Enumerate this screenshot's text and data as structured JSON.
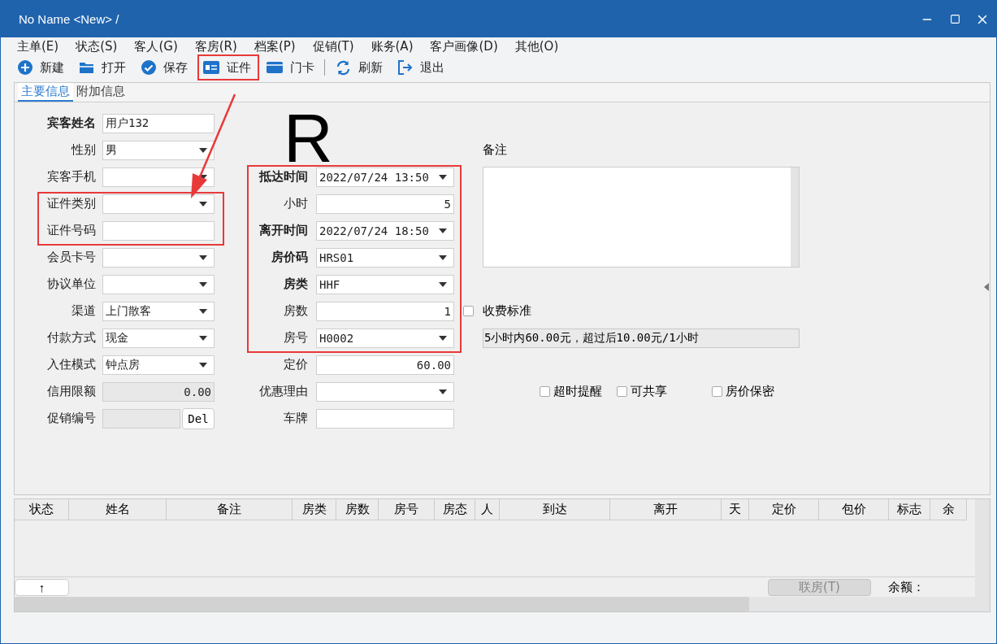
{
  "window": {
    "title": "No Name <New> /"
  },
  "menu": [
    "主单(E)",
    "状态(S)",
    "客人(G)",
    "客房(R)",
    "档案(P)",
    "促销(T)",
    "账务(A)",
    "客户画像(D)",
    "其他(O)"
  ],
  "toolbar": [
    {
      "kind": "new",
      "label": "新建",
      "highlighted": false
    },
    {
      "kind": "open",
      "label": "打开",
      "highlighted": false
    },
    {
      "kind": "save",
      "label": "保存",
      "highlighted": false
    },
    {
      "kind": "id",
      "label": "证件",
      "highlighted": true
    },
    {
      "kind": "card",
      "label": "门卡",
      "highlighted": false
    },
    {
      "kind": "separator"
    },
    {
      "kind": "refresh",
      "label": "刷新",
      "highlighted": false
    },
    {
      "kind": "exit",
      "label": "退出",
      "highlighted": false
    }
  ],
  "tabs": [
    {
      "label": "主要信息",
      "selected": true
    },
    {
      "label": "附加信息",
      "selected": false
    }
  ],
  "marker": "R",
  "left_fields": [
    {
      "label": "宾客姓名",
      "bold": true,
      "kind": "text",
      "value": "用户132",
      "highlighted": false
    },
    {
      "label": "性别",
      "bold": false,
      "kind": "dropdown",
      "value": "男",
      "highlighted": false
    },
    {
      "label": "宾客手机",
      "bold": false,
      "kind": "dropdown",
      "highlighted": false
    },
    {
      "label": "证件类别",
      "bold": false,
      "kind": "dropdown",
      "highlighted": true
    },
    {
      "label": "证件号码",
      "bold": false,
      "kind": "text",
      "highlighted": true
    },
    {
      "label": "会员卡号",
      "bold": false,
      "kind": "dropdown",
      "highlighted": false
    },
    {
      "label": "协议单位",
      "bold": false,
      "kind": "dropdown",
      "highlighted": false
    },
    {
      "label": "渠道",
      "bold": false,
      "kind": "dropdown",
      "value": "上门散客",
      "highlighted": false
    },
    {
      "label": "付款方式",
      "bold": false,
      "kind": "dropdown",
      "value": "现金",
      "highlighted": false
    },
    {
      "label": "入住模式",
      "bold": false,
      "kind": "dropdown",
      "value": "钟点房",
      "highlighted": false
    },
    {
      "label": "信用限额",
      "bold": false,
      "kind": "readonly",
      "value": "0.00",
      "highlighted": false
    },
    {
      "label": "促销编号",
      "bold": false,
      "kind": "promo",
      "button": "Del",
      "highlighted": false
    }
  ],
  "middle_fields": [
    {
      "label": "抵达时间",
      "bold": true,
      "kind": "dropdown",
      "value": "2022/07/24 13:50",
      "highlighted": true
    },
    {
      "label": "小时",
      "bold": false,
      "kind": "number",
      "value": "5",
      "highlighted": true
    },
    {
      "label": "离开时间",
      "bold": true,
      "kind": "dropdown",
      "value": "2022/07/24 18:50",
      "highlighted": true
    },
    {
      "label": "房价码",
      "bold": true,
      "kind": "dropdown",
      "value": "HRS01",
      "highlighted": true
    },
    {
      "label": "房类",
      "bold": true,
      "kind": "dropdown",
      "value": "HHF",
      "highlighted": true
    },
    {
      "label": "房数",
      "bold": false,
      "kind": "number",
      "value": "1",
      "highlighted": true
    },
    {
      "label": "房号",
      "bold": false,
      "kind": "dropdown",
      "value": "H0002",
      "highlighted": true
    },
    {
      "label": "定价",
      "bold": false,
      "kind": "number",
      "value": "60.00",
      "highlighted": false
    },
    {
      "label": "优惠理由",
      "bold": false,
      "kind": "dropdown",
      "highlighted": false
    },
    {
      "label": "车牌",
      "bold": false,
      "kind": "text",
      "highlighted": false
    }
  ],
  "notes": {
    "label": "备注"
  },
  "fee_standard": {
    "label": "收费标准",
    "checked": false,
    "text": "5小时内60.00元，超过后10.00元/1小时"
  },
  "options": [
    {
      "label": "超时提醒",
      "checked": false
    },
    {
      "label": "可共享",
      "checked": false
    },
    {
      "label": "房价保密",
      "checked": false
    }
  ],
  "table": {
    "columns": [
      "状态",
      "姓名",
      "备注",
      "房类",
      "房数",
      "房号",
      "房态",
      "人",
      "到达",
      "离开",
      "天",
      "定价",
      "包价",
      "标志",
      "余"
    ]
  },
  "footer": {
    "up_button": "↑",
    "link_button": {
      "label": "联房(T)",
      "disabled": true
    },
    "balance_label": "余额："
  }
}
